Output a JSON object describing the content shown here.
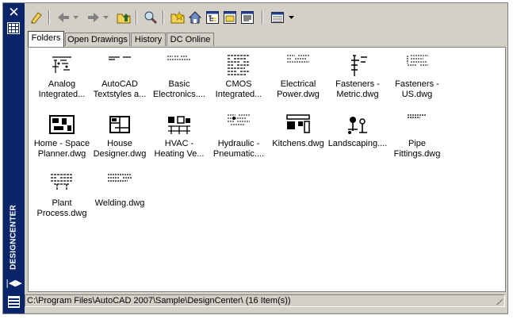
{
  "palette": {
    "title": "DESIGNCENTER",
    "close_icon": "close-icon",
    "properties_icon": "properties-icon",
    "autohide_icon": "autohide-icon",
    "menu_icon": "palette-menu-icon"
  },
  "toolbar": {
    "icons": [
      "load-icon",
      "back-icon",
      "forward-icon",
      "up-icon",
      "search-icon",
      "favorites-icon",
      "home-icon",
      "tree-view-toggle-icon",
      "preview-icon",
      "description-icon",
      "views-icon"
    ]
  },
  "tabs": [
    {
      "label": "Folders",
      "active": true
    },
    {
      "label": "Open Drawings",
      "active": false
    },
    {
      "label": "History",
      "active": false
    },
    {
      "label": "DC Online",
      "active": false
    }
  ],
  "items": [
    {
      "label_lines": [
        "Analog",
        "Integrated..."
      ]
    },
    {
      "label_lines": [
        "AutoCAD",
        "Textstyles a..."
      ]
    },
    {
      "label_lines": [
        "Basic",
        "Electronics...."
      ]
    },
    {
      "label_lines": [
        "CMOS",
        "Integrated..."
      ]
    },
    {
      "label_lines": [
        "Electrical",
        "Power.dwg"
      ]
    },
    {
      "label_lines": [
        "Fasteners -",
        "Metric.dwg"
      ]
    },
    {
      "label_lines": [
        "Fasteners -",
        "US.dwg"
      ]
    },
    {
      "label_lines": [
        "Home - Space",
        "Planner.dwg"
      ]
    },
    {
      "label_lines": [
        "House",
        "Designer.dwg"
      ]
    },
    {
      "label_lines": [
        "HVAC -",
        "Heating Ve..."
      ]
    },
    {
      "label_lines": [
        "Hydraulic -",
        "Pneumatic...."
      ]
    },
    {
      "label_lines": [
        "Kitchens.dwg",
        ""
      ]
    },
    {
      "label_lines": [
        "Landscaping....",
        ""
      ]
    },
    {
      "label_lines": [
        "Pipe",
        "Fittings.dwg"
      ]
    },
    {
      "label_lines": [
        "Plant",
        "Process.dwg"
      ]
    },
    {
      "label_lines": [
        "Welding.dwg",
        ""
      ]
    }
  ],
  "status": {
    "text": "C:\\Program Files\\AutoCAD 2007\\Sample\\DesignCenter\\ (16 Item(s))"
  },
  "colors": {
    "palette_bar": "#0a246a",
    "window_bg": "#d4d0c8",
    "content_bg": "#ffffff"
  }
}
